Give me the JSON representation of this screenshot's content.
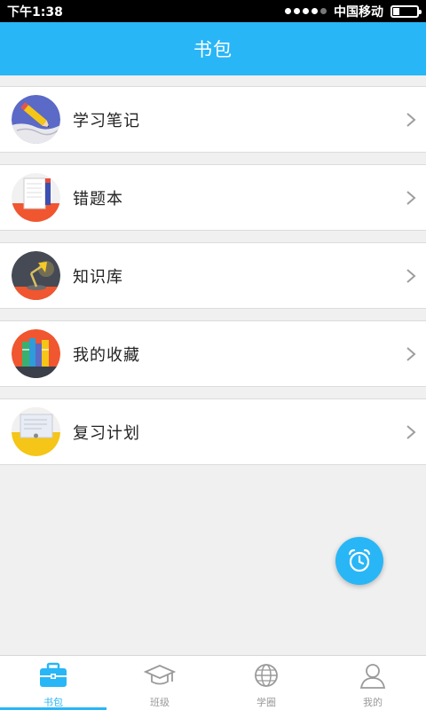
{
  "status_bar": {
    "time": "下午1:38",
    "carrier": "中国移动"
  },
  "header": {
    "title": "书包"
  },
  "menu": [
    {
      "label": "学习笔记",
      "icon": "notebook-pencil-icon"
    },
    {
      "label": "错题本",
      "icon": "error-book-icon"
    },
    {
      "label": "知识库",
      "icon": "desk-lamp-icon"
    },
    {
      "label": "我的收藏",
      "icon": "bookshelf-icon"
    },
    {
      "label": "复习计划",
      "icon": "review-plan-icon"
    }
  ],
  "fab": {
    "icon": "alarm-clock-icon"
  },
  "bottom_nav": [
    {
      "label": "书包",
      "icon": "briefcase-icon",
      "active": true
    },
    {
      "label": "班级",
      "icon": "graduation-cap-icon",
      "active": false
    },
    {
      "label": "学圈",
      "icon": "globe-icon",
      "active": false
    },
    {
      "label": "我的",
      "icon": "user-icon",
      "active": false
    }
  ],
  "colors": {
    "primary": "#29b6f6",
    "background": "#f0f0f0"
  }
}
